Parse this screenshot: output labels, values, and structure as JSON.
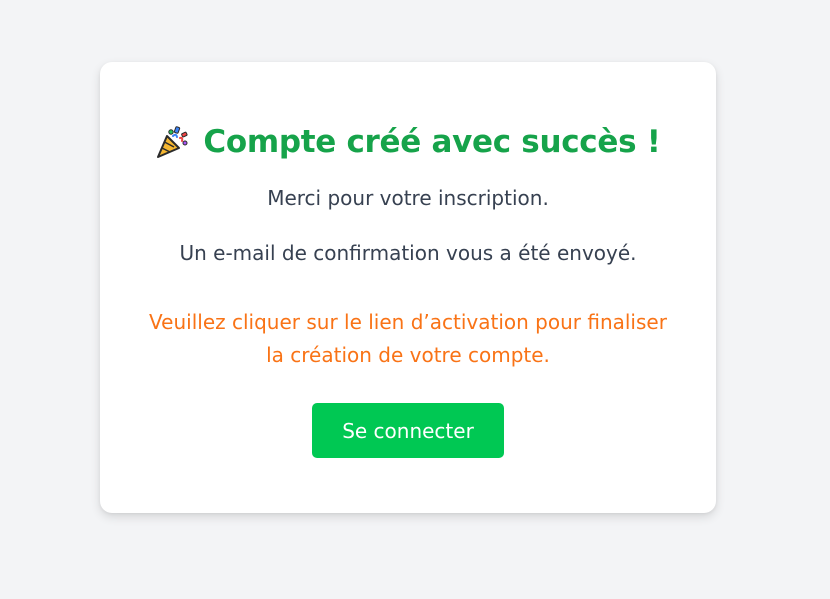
{
  "card": {
    "title_icon": "party-popper-icon",
    "title": "Compte créé avec succès !",
    "thanks_text": "Merci pour votre inscription.",
    "sent_text": "Un e-mail de confirmation vous a été envoyé.",
    "warning_text": "Veuillez cliquer sur le lien d’activation pour finaliser la création de votre compte.",
    "login_button_label": "Se connecter"
  },
  "colors": {
    "title": "#16a34a",
    "warning": "#f97316",
    "button": "#00c853",
    "background": "#f3f4f6"
  }
}
